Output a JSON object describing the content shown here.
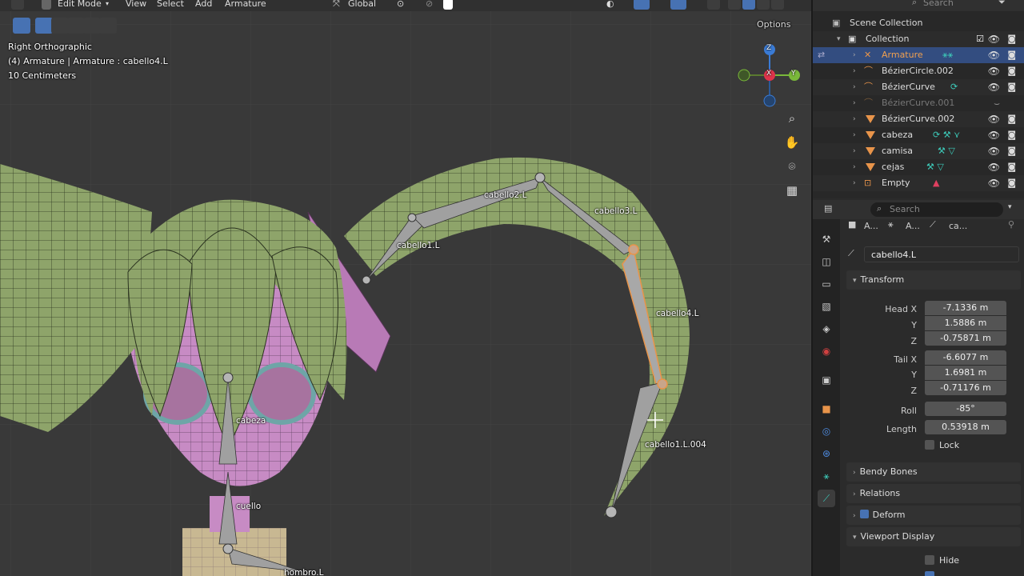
{
  "viewport_header": {
    "mode": "Edit Mode",
    "menus": [
      "View",
      "Select",
      "Add",
      "Armature"
    ],
    "transform_orientation": "Global",
    "options_label": "Options"
  },
  "viewport_overlay": {
    "view_name": "Right Orthographic",
    "active_info": "(4) Armature | Armature : cabello4.L",
    "scale": "10 Centimeters"
  },
  "gizmo": {
    "z": "Z",
    "y": "Y",
    "x": "X"
  },
  "bones": [
    {
      "label": "cabello2.L"
    },
    {
      "label": "cabello3.L"
    },
    {
      "label": "cabello1.L"
    },
    {
      "label": "cabello4.L"
    },
    {
      "label": "cabeza"
    },
    {
      "label": "cabello1.L.004"
    },
    {
      "label": "cuello"
    },
    {
      "label": "hombro.L"
    }
  ],
  "outliner": {
    "search_placeholder": "Search",
    "scene_collection": "Scene Collection",
    "collection": "Collection",
    "items": [
      {
        "label": "Armature",
        "selected": true
      },
      {
        "label": "BézierCircle.002"
      },
      {
        "label": "BézierCurve"
      },
      {
        "label": "BézierCurve.001",
        "dim": true
      },
      {
        "label": "BézierCurve.002"
      },
      {
        "label": "cabeza"
      },
      {
        "label": "camisa"
      },
      {
        "label": "cejas"
      },
      {
        "label": "Empty"
      }
    ]
  },
  "properties": {
    "search_placeholder": "Search",
    "breadcrumb": [
      "A...",
      "A...",
      "ca..."
    ],
    "bone_name": "cabello4.L",
    "transform": {
      "title": "Transform",
      "head_x_label": "Head X",
      "head_x": "-7.1336 m",
      "head_y_label": "Y",
      "head_y": "1.5886 m",
      "head_z_label": "Z",
      "head_z": "-0.75871 m",
      "tail_x_label": "Tail X",
      "tail_x": "-6.6077 m",
      "tail_y_label": "Y",
      "tail_y": "1.6981 m",
      "tail_z_label": "Z",
      "tail_z": "-0.71176 m",
      "roll_label": "Roll",
      "roll": "-85°",
      "length_label": "Length",
      "length": "0.53918 m",
      "lock_label": "Lock"
    },
    "panels": {
      "bendy_bones": "Bendy Bones",
      "relations": "Relations",
      "deform": "Deform",
      "viewport_display": "Viewport Display",
      "hide": "Hide"
    }
  },
  "colors": {
    "selected_bone_outline": "#e8944a",
    "mesh_hair": "#8ea46a",
    "mesh_face": "#c78bc4",
    "accent": "#4772b3"
  }
}
